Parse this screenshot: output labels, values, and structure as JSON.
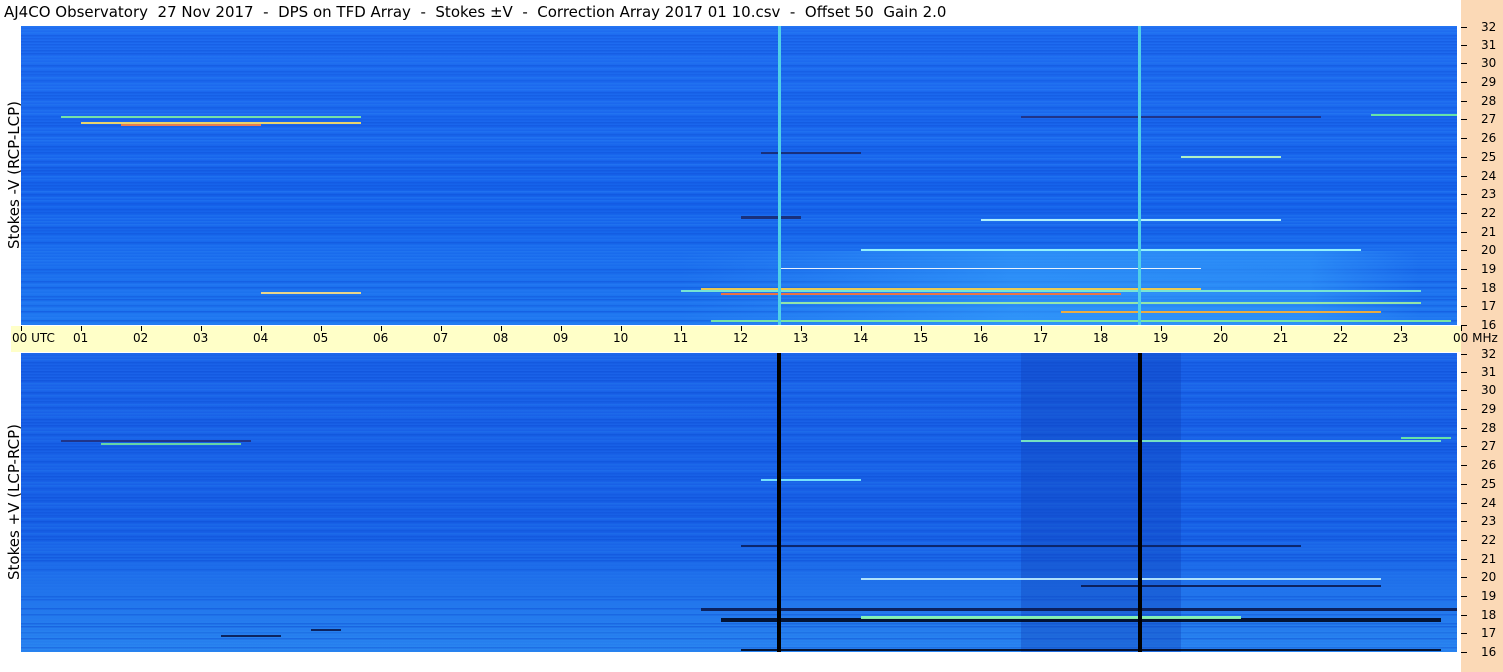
{
  "title": "AJ4CO Observatory  27 Nov 2017  -  DPS on TFD Array  -  Stokes ±V  -  Correction Array 2017 01 10.csv  -  Offset 50  Gain 2.0",
  "colors": {
    "background": "#1a5ee6",
    "axis_strip": "#ffffc8",
    "right_strip": "#fbd9b6"
  },
  "chart_data": [
    {
      "type": "heatmap",
      "ylabel": "Stokes -V (RCP-LCP)",
      "x_ticks": [
        "00 UTC",
        "01",
        "02",
        "03",
        "04",
        "05",
        "06",
        "07",
        "08",
        "09",
        "10",
        "11",
        "12",
        "13",
        "14",
        "15",
        "16",
        "17",
        "18",
        "19",
        "20",
        "21",
        "22",
        "23",
        "00 MHz"
      ],
      "y_ticks": [
        "32",
        "31",
        "30",
        "29",
        "28",
        "27",
        "26",
        "25",
        "24",
        "23",
        "22",
        "21",
        "20",
        "19",
        "18",
        "17",
        "16"
      ],
      "xlim": [
        0,
        24
      ],
      "ylim": [
        16,
        32
      ]
    },
    {
      "type": "heatmap",
      "ylabel": "Stokes +V (LCP-RCP)",
      "x_ticks": [
        "00 UTC",
        "01",
        "02",
        "03",
        "04",
        "05",
        "06",
        "07",
        "08",
        "09",
        "10",
        "11",
        "12",
        "13",
        "14",
        "15",
        "16",
        "17",
        "18",
        "19",
        "20",
        "21",
        "22",
        "23",
        "00 MHz"
      ],
      "y_ticks": [
        "32",
        "31",
        "30",
        "29",
        "28",
        "27",
        "26",
        "25",
        "24",
        "23",
        "22",
        "21",
        "20",
        "19",
        "18",
        "17",
        "16"
      ],
      "xlim": [
        0,
        24
      ],
      "ylim": [
        16,
        32
      ]
    }
  ]
}
